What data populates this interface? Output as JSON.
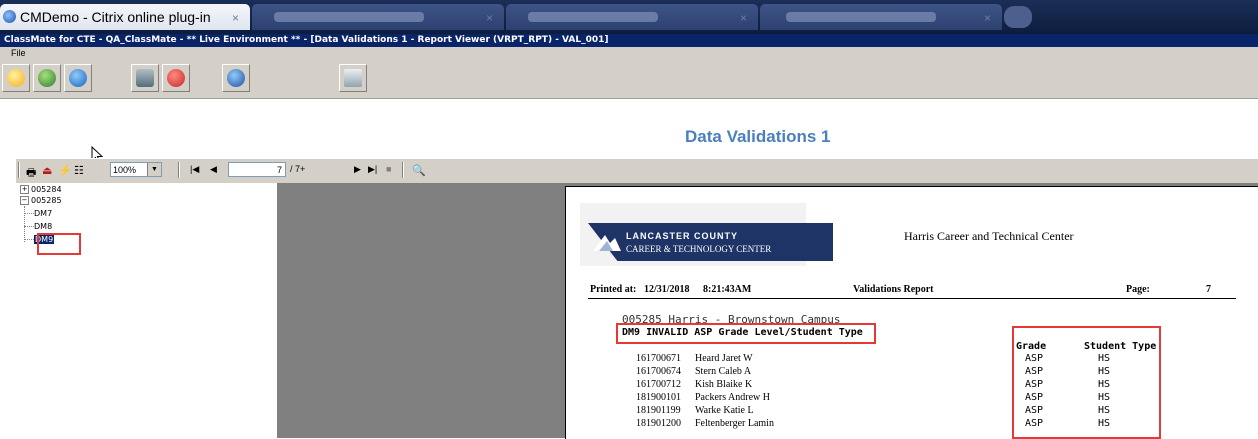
{
  "citrix": {
    "active_tab_title": "CMDemo - Citrix online plug-in",
    "tab_close": "×"
  },
  "app": {
    "window_title": "ClassMate for CTE - QA_ClassMate - ** Live Environment ** - [Data Validations 1 - Report Viewer (VRPT_RPT) - VAL_001]",
    "menu_file": "File"
  },
  "toolbar": {
    "buttons": [
      "smiley-icon",
      "refresh-icon",
      "info-icon",
      "people-icon",
      "cancel-icon",
      "help-icon",
      "print-icon"
    ]
  },
  "report": {
    "title": "Data Validations 1"
  },
  "viewer": {
    "zoom": "100%",
    "page_current": "7",
    "page_total": "/ 7+"
  },
  "tree": {
    "nodes": [
      "005284",
      "005285",
      "DM7",
      "DM8",
      "DM9"
    ],
    "expand_plus": "+",
    "expand_minus": "−"
  },
  "page": {
    "logo_line1": "LANCASTER COUNTY",
    "logo_line2": "CAREER & TECHNOLOGY CENTER",
    "school": "Harris Career and Technical Center",
    "printed_label": "Printed at:",
    "printed_date": "12/31/2018",
    "printed_time": "8:21:43AM",
    "report_name": "Validations Report",
    "page_label": "Page:",
    "page_number": "7",
    "campus": "005285    Harris - Brownstown Campus",
    "validation_title": "DM9 INVALID ASP Grade Level/Student Type",
    "col_grade": "Grade",
    "col_student_type": "Student Type",
    "rows": [
      {
        "id": "161700671",
        "name": "Heard Jaret W",
        "grade": "ASP",
        "type": "HS"
      },
      {
        "id": "161700674",
        "name": "Stern Caleb A",
        "grade": "ASP",
        "type": "HS"
      },
      {
        "id": "161700712",
        "name": "Kish Blaike K",
        "grade": "ASP",
        "type": "HS"
      },
      {
        "id": "181900101",
        "name": "Packers Andrew H",
        "grade": "ASP",
        "type": "HS"
      },
      {
        "id": "181901199",
        "name": "Warke Katie L",
        "grade": "ASP",
        "type": "HS"
      },
      {
        "id": "181901200",
        "name": "Feltenberger Lamin",
        "grade": "ASP",
        "type": "HS"
      }
    ]
  }
}
